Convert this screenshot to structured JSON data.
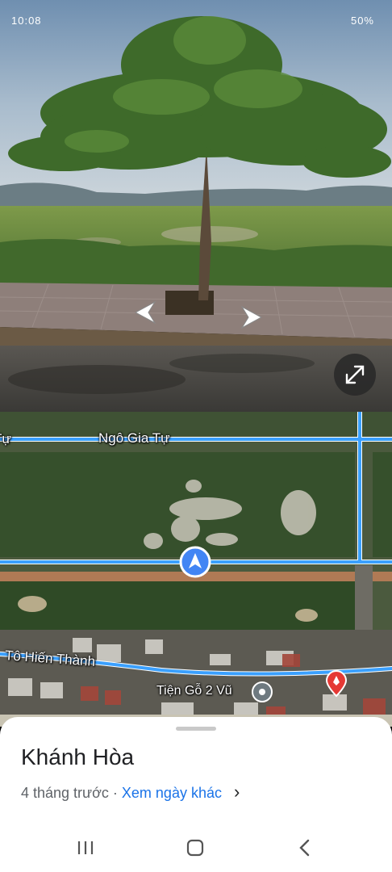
{
  "status_bar": {
    "left_text": "10:08",
    "right_text": "50%"
  },
  "street_view": {
    "prev_arrow_label": "previous",
    "next_arrow_label": "next",
    "expand_icon": "expand-icon"
  },
  "map": {
    "roads": [
      "Ngô Gia Tự",
      "Tô Hiến Thành"
    ],
    "partial_road_label": "Tự",
    "poi_label": "Tiện Gỗ 2 Vũ",
    "colors": {
      "road": "#3aa0ff",
      "location_marker": "#4285f4",
      "poi_pin": "#e53935"
    }
  },
  "sheet": {
    "place_name": "Khánh Hòa",
    "time_ago": "4 tháng trước",
    "separator": " · ",
    "other_dates_link": "Xem ngày khác",
    "chevron": "›"
  }
}
